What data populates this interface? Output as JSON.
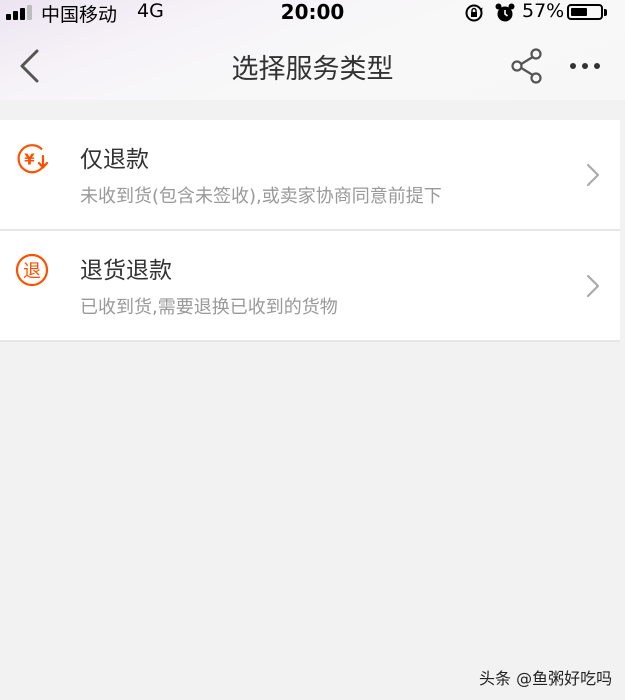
{
  "status_bar": {
    "carrier": "中国移动",
    "network": "4G",
    "time": "20:00",
    "battery_percent": "57%",
    "battery_level": 0.57,
    "signal_bars": 3
  },
  "nav": {
    "title": "选择服务类型",
    "back_icon": "chevron-left-icon",
    "share_icon": "share-icon",
    "more_icon": "more-dots-icon"
  },
  "options": [
    {
      "title": "仅退款",
      "description": "未收到货(包含未签收),或卖家协商同意前提下",
      "icon": "refund-yuan-icon"
    },
    {
      "title": "退货退款",
      "description": "已收到货,需要退换已收到的货物",
      "icon": "return-tui-icon",
      "icon_glyph": "退"
    }
  ],
  "colors": {
    "accent": "#ff5000",
    "background": "#f2f2f2",
    "title_text": "#333333",
    "secondary_text": "#999999"
  },
  "watermark": "头条 @鱼粥好吃吗"
}
